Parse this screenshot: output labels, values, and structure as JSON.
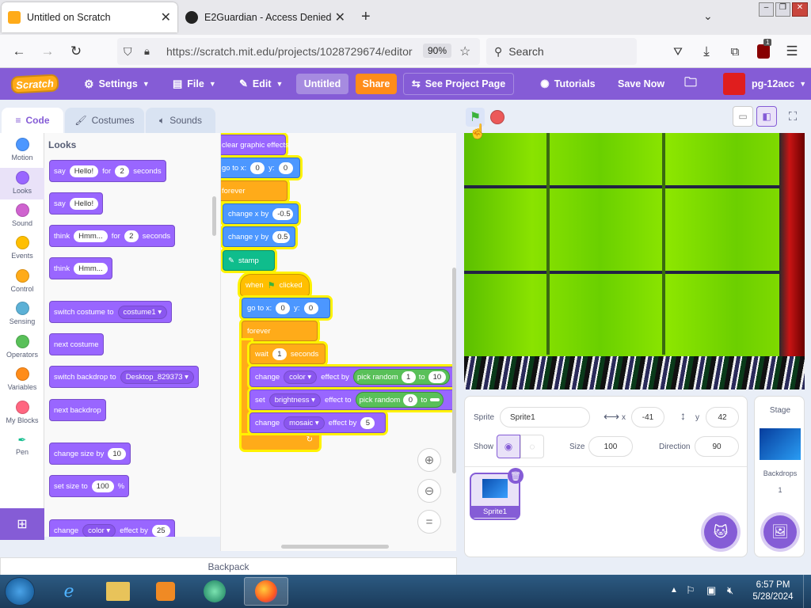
{
  "browser": {
    "tabs": [
      {
        "title": "Untitled on Scratch",
        "active": true
      },
      {
        "title": "E2Guardian - Access Denied",
        "active": false
      }
    ],
    "url": "https://scratch.mit.edu/projects/1028729674/editor",
    "zoom": "90%",
    "search_placeholder": "Search",
    "extension_badge": "1"
  },
  "menubar": {
    "logo": "Scratch",
    "settings": "Settings",
    "file": "File",
    "edit": "Edit",
    "project_title": "Untitled",
    "share": "Share",
    "see_project_page": "See Project Page",
    "tutorials": "Tutorials",
    "save_now": "Save Now",
    "username": "pg-12acc"
  },
  "editor_tabs": {
    "code": "Code",
    "costumes": "Costumes",
    "sounds": "Sounds"
  },
  "categories": [
    {
      "label": "Motion",
      "color": "#4c97ff"
    },
    {
      "label": "Looks",
      "color": "#9966ff"
    },
    {
      "label": "Sound",
      "color": "#cf63cf"
    },
    {
      "label": "Events",
      "color": "#ffbf00"
    },
    {
      "label": "Control",
      "color": "#ffab19"
    },
    {
      "label": "Sensing",
      "color": "#5cb1d6"
    },
    {
      "label": "Operators",
      "color": "#59c059"
    },
    {
      "label": "Variables",
      "color": "#ff8c1a"
    },
    {
      "label": "My Blocks",
      "color": "#ff6680"
    },
    {
      "label": "Pen",
      "color": "#0fbd8c"
    }
  ],
  "palette": {
    "heading": "Looks",
    "say_for": {
      "say": "say",
      "msg": "Hello!",
      "for": "for",
      "secs": "2",
      "unit": "seconds"
    },
    "say": {
      "say": "say",
      "msg": "Hello!"
    },
    "think_for": {
      "think": "think",
      "msg": "Hmm...",
      "for": "for",
      "secs": "2",
      "unit": "seconds"
    },
    "think": {
      "think": "think",
      "msg": "Hmm..."
    },
    "switch_costume": {
      "label": "switch costume to",
      "value": "costume1"
    },
    "next_costume": "next costume",
    "switch_backdrop": {
      "label": "switch backdrop to",
      "value": "Desktop_829373"
    },
    "next_backdrop": "next backdrop",
    "change_size": {
      "label": "change size by",
      "value": "10"
    },
    "set_size": {
      "label": "set size to",
      "value": "100",
      "unit": "%"
    },
    "change_effect": {
      "label": "change",
      "effect": "color",
      "by": "effect by",
      "value": "25"
    }
  },
  "script_a": {
    "clear": "clear graphic effects",
    "goto": {
      "label": "go to x:",
      "x": "0",
      "ylabel": "y:",
      "y": "0"
    },
    "forever": "forever",
    "change_x": {
      "label": "change x by",
      "value": "-0.5"
    },
    "change_y": {
      "label": "change y by",
      "value": "0.5"
    },
    "stamp": "stamp"
  },
  "script_b": {
    "hat": {
      "when": "when",
      "clicked": "clicked"
    },
    "goto": {
      "label": "go to x:",
      "x": "0",
      "ylabel": "y:",
      "y": "0"
    },
    "forever": "forever",
    "wait": {
      "label": "wait",
      "value": "1",
      "unit": "seconds"
    },
    "change_color": {
      "label": "change",
      "effect": "color",
      "by": "effect by",
      "rand": "pick random",
      "from": "1",
      "to": "to",
      "to_val": "10"
    },
    "set_brightness": {
      "label": "set",
      "effect": "brightness",
      "to": "effect to",
      "rand": "pick random",
      "from": "0",
      "to2": "to"
    },
    "change_mosaic": {
      "label": "change",
      "effect": "mosaic",
      "by": "effect by",
      "value": "5"
    }
  },
  "sprite_info": {
    "sprite_label": "Sprite",
    "sprite_name": "Sprite1",
    "x_label": "x",
    "x": "-41",
    "y_label": "y",
    "y": "42",
    "show_label": "Show",
    "size_label": "Size",
    "size": "100",
    "direction_label": "Direction",
    "direction": "90",
    "thumb_name": "Sprite1"
  },
  "stage_pane": {
    "title": "Stage",
    "backdrops_label": "Backdrops",
    "backdrops_count": "1"
  },
  "backpack": "Backpack",
  "taskbar": {
    "time": "6:57 PM",
    "date": "5/28/2024"
  }
}
